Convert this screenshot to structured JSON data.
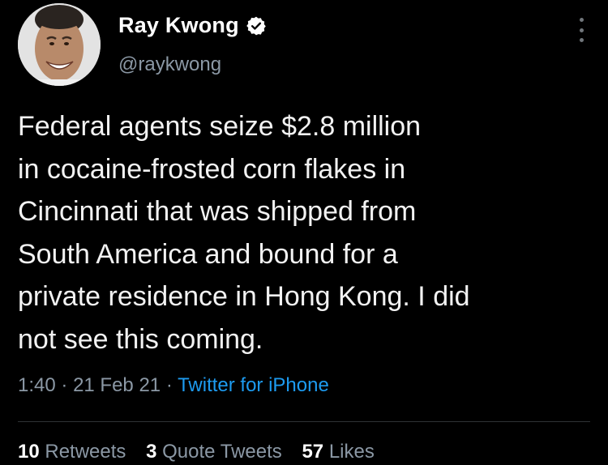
{
  "user": {
    "display_name": "Ray Kwong",
    "handle": "@raykwong",
    "verified": true,
    "avatar_icon": "profile-photo"
  },
  "tweet": {
    "text": "Federal agents seize $2.8 million\nin cocaine-frosted corn flakes in\nCincinnati that was shipped from\nSouth America and bound for a\nprivate residence in Hong Kong. I did\nnot see this coming.",
    "time": "1:40",
    "date": "21 Feb 21",
    "separator": "·",
    "source": "Twitter for iPhone"
  },
  "stats": {
    "retweets_count": "10",
    "retweets_label": "Retweets",
    "quotes_count": "3",
    "quotes_label": "Quote Tweets",
    "likes_count": "57",
    "likes_label": "Likes"
  },
  "colors": {
    "background": "#000000",
    "text": "#f2f2f2",
    "secondary": "#8b98a5",
    "link": "#1d9bf0"
  }
}
